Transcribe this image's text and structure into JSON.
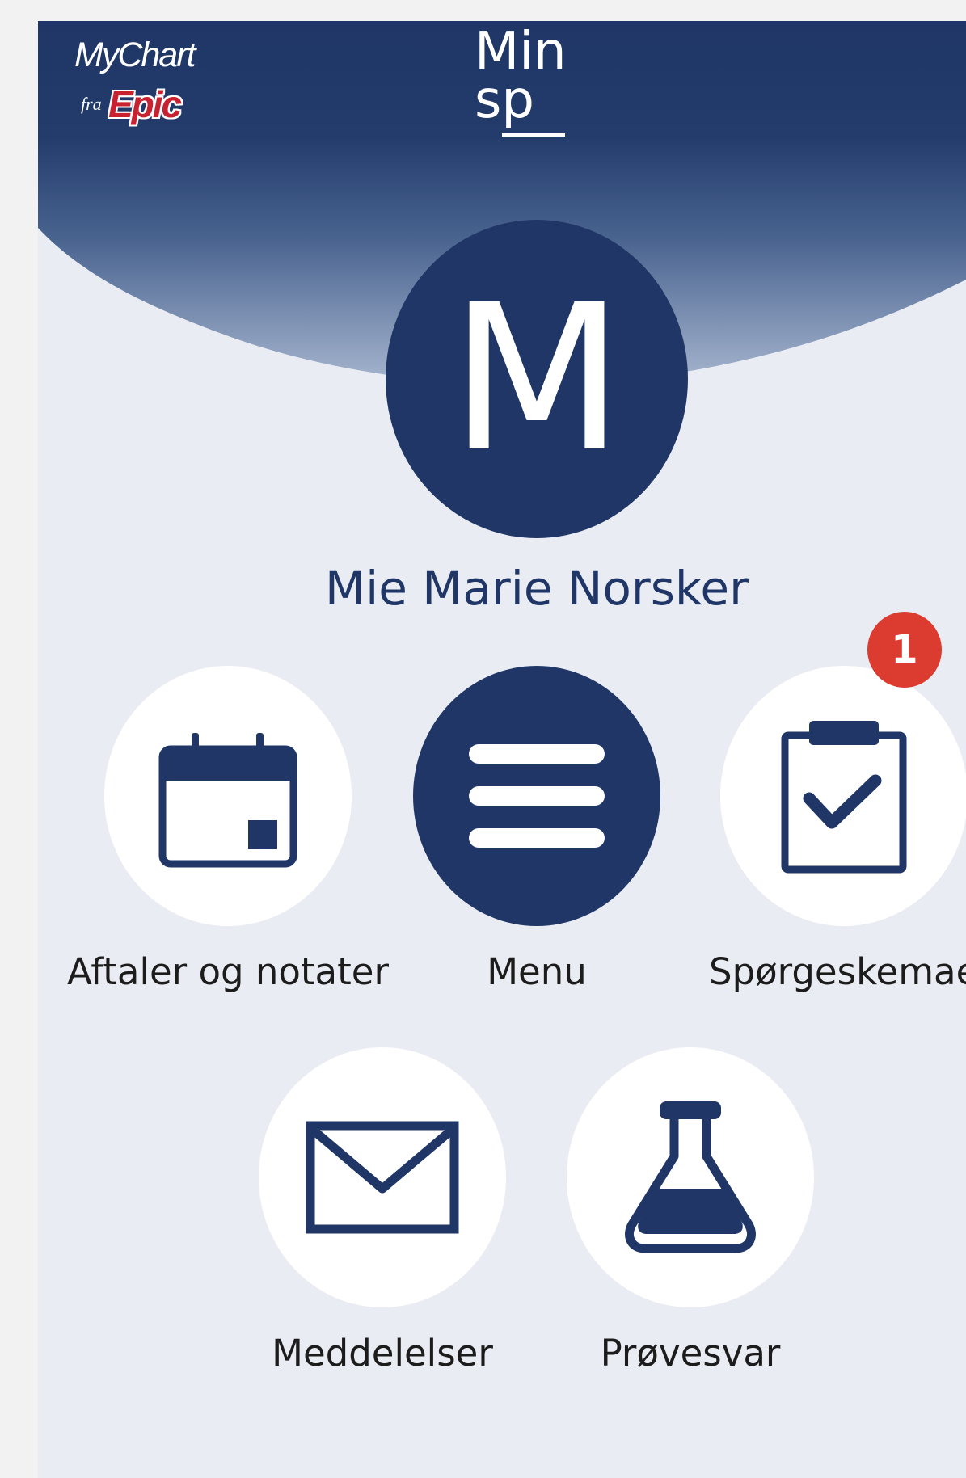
{
  "app": {
    "logo_line1": "MyChart",
    "logo_fra": "fra",
    "logo_epic": "Epic",
    "title_line1": "Min",
    "title_line2": "sp"
  },
  "user": {
    "initial": "M",
    "name": "Mie Marie Norsker"
  },
  "tiles": [
    {
      "label": "Aftaler og notater",
      "icon": "calendar-icon"
    },
    {
      "label": "Menu",
      "icon": "hamburger-menu-icon"
    },
    {
      "label": "Spørgeskemae",
      "icon": "clipboard-check-icon",
      "badge": "1"
    },
    {
      "label": "Meddelelser",
      "icon": "envelope-icon"
    },
    {
      "label": "Prøvesvar",
      "icon": "flask-icon"
    }
  ],
  "colors": {
    "navy": "#1f3666",
    "background": "#e9ecf2",
    "badge_red": "#dc3b30",
    "epic_red": "#c8212f"
  }
}
